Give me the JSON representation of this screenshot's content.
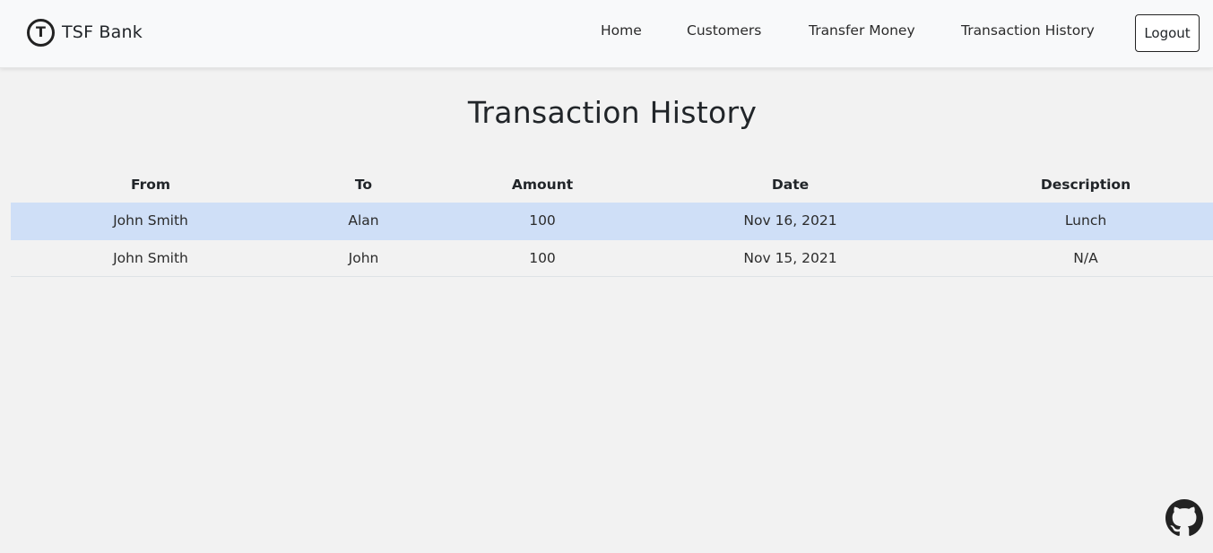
{
  "navbar": {
    "brand_logo_letter": "T",
    "brand_name": "TSF Bank",
    "links": [
      {
        "label": "Home"
      },
      {
        "label": "Customers"
      },
      {
        "label": "Transfer Money"
      },
      {
        "label": "Transaction History"
      }
    ],
    "logout_label": "Logout"
  },
  "page": {
    "title": "Transaction History"
  },
  "table": {
    "columns": [
      "From",
      "To",
      "Amount",
      "Date",
      "Description"
    ],
    "rows": [
      {
        "from": "John Smith",
        "to": "Alan",
        "amount": "100",
        "date": "Nov 16, 2021",
        "description": "Lunch",
        "highlighted": true
      },
      {
        "from": "John Smith",
        "to": "John",
        "amount": "100",
        "date": "Nov 15, 2021",
        "description": "N/A",
        "highlighted": false
      }
    ]
  },
  "footer": {
    "icon": "github-icon"
  },
  "colors": {
    "navbar_bg": "#f8f9fa",
    "page_bg": "#f2f2f2",
    "highlight_row": "#cfdff7"
  }
}
